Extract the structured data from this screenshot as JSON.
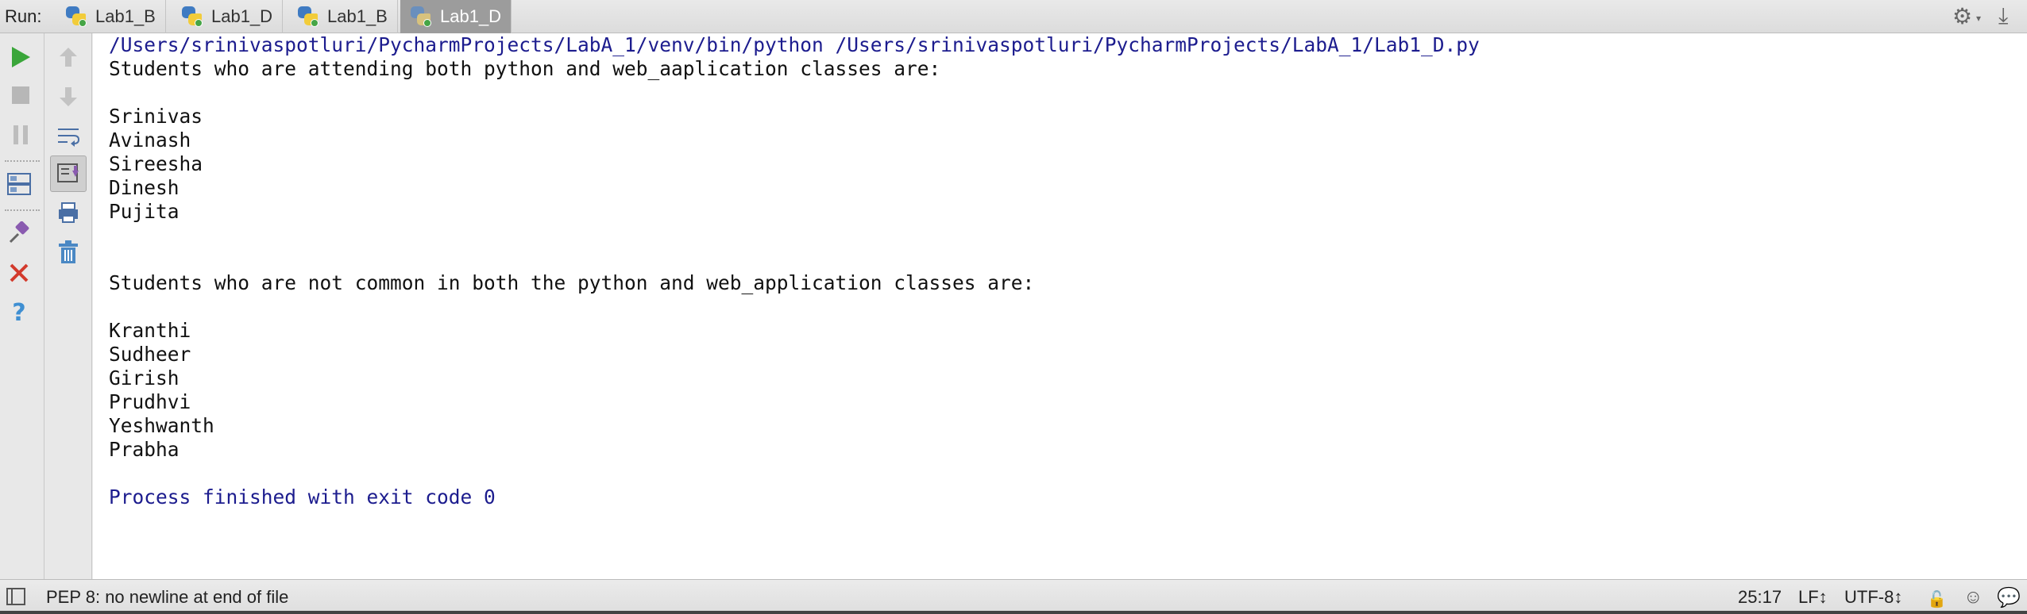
{
  "runbar": {
    "label": "Run:",
    "tabs": [
      {
        "label": "Lab1_B",
        "active": false
      },
      {
        "label": "Lab1_D",
        "active": false
      },
      {
        "label": "Lab1_B",
        "active": false
      },
      {
        "label": "Lab1_D",
        "active": true
      }
    ],
    "settings_icon": "gear-icon",
    "pin_icon": "download-pin-icon"
  },
  "toolbar_left": {
    "icons": [
      "run-icon",
      "stop-icon",
      "pause-icon",
      "layout-icon",
      "pin-tab-icon",
      "close-icon",
      "help-icon"
    ],
    "colors": {
      "run": "#3aa63a",
      "close": "#d33a2c",
      "help": "#3f8fd2"
    }
  },
  "toolbar_right": {
    "icons": [
      "up-arrow-icon",
      "down-arrow-icon",
      "soft-wrap-icon",
      "scroll-to-end-icon",
      "print-icon",
      "trash-icon"
    ]
  },
  "console": {
    "command": "/Users/srinivaspotluri/PycharmProjects/LabA_1/venv/bin/python /Users/srinivaspotluri/PycharmProjects/LabA_1/Lab1_D.py",
    "heading1": "Students who are attending both python and web_aaplication classes are:",
    "common_students": [
      "Srinivas",
      "Avinash",
      "Sireesha",
      "Dinesh",
      "Pujita"
    ],
    "heading2": "Students who are not common in both the python and web_application classes are:",
    "uncommon_students": [
      "Kranthi",
      "Sudheer",
      "Girish",
      "Prudhvi",
      "Yeshwanth",
      "Prabha"
    ],
    "exit_message": "Process finished with exit code 0"
  },
  "statusbar": {
    "message": "PEP 8: no newline at end of file",
    "position": "25:17",
    "line_separator": "LF↕",
    "encoding": "UTF-8↕"
  }
}
